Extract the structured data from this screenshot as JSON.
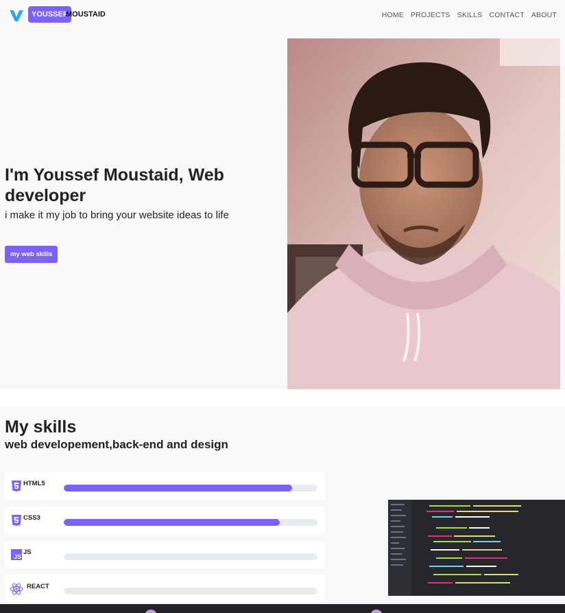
{
  "nav": {
    "brand_highlight": "YOUSSEF",
    "brand_rest": "MOUSTAID",
    "links": [
      "HOME",
      "PROJECTS",
      "SKILLS",
      "CONTACT",
      "ABOUT"
    ]
  },
  "hero": {
    "title": "I'm Youssef Moustaid, Web developer",
    "subtitle": "i make it my job to bring your website ideas to life",
    "button_label": "my web skills"
  },
  "skills": {
    "title": "My skills",
    "subtitle": "web developement,back-end and design",
    "items": [
      {
        "name": "HTML5",
        "icon": "html5-icon",
        "level": 0.9
      },
      {
        "name": "CSS3",
        "icon": "css3-icon",
        "level": 0.85
      },
      {
        "name": "JS",
        "icon": "js-icon",
        "level": 0.0
      },
      {
        "name": "REACT",
        "icon": "react-icon",
        "level": 0.0
      }
    ]
  },
  "colors": {
    "accent": "#7b61ff",
    "page_bg": "#f8f9fb",
    "track": "#e9ecef"
  }
}
